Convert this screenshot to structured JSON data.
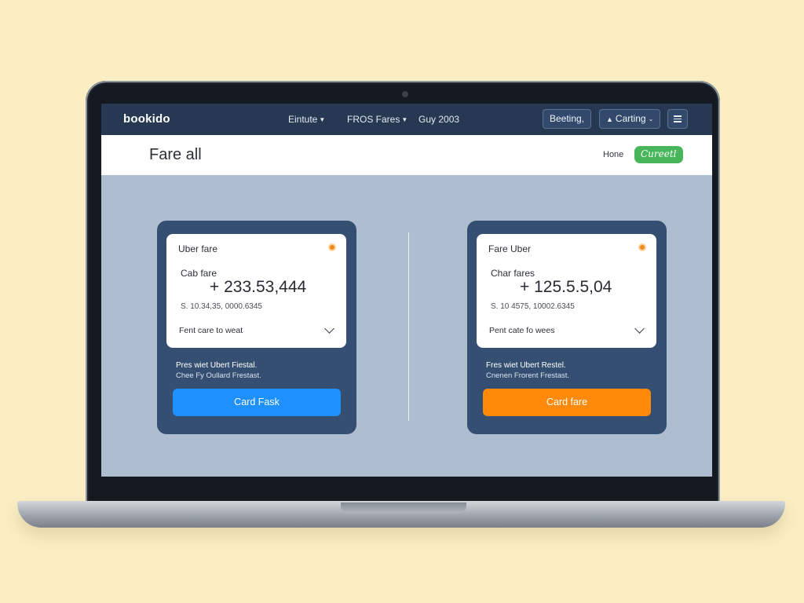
{
  "navbar": {
    "logo": "bookido",
    "links": [
      "Eintute",
      "FROS Fares",
      "Guy 2003"
    ],
    "booking_label": "Beeting,",
    "setting_label": "Carting"
  },
  "titlebar": {
    "title": "Fare all",
    "home_label": "Hone",
    "current_label": "Cureetl"
  },
  "cards": [
    {
      "header": "Uber fare",
      "label": "Cab fare",
      "amount": "+ 233.53,444",
      "sub": "S. 10.34,35, 0000.6345",
      "select": "Fent care to weat",
      "note1": "Pres wiet Ubert Fiestal.",
      "note2": "Chee  Fy Oullard Frestast.",
      "button_label": "Card Fask",
      "button_color": "#1e90ff"
    },
    {
      "header": "Fare Uber",
      "label": "Char fares",
      "amount": "+ 125.5.5,04",
      "sub": "S. 10 4575, 10002.6345",
      "select": "Pent cate fo wees",
      "note1": "Fres wiet Ubert Restel.",
      "note2": "Cnenen Frorent Frestast.",
      "button_label": "Card fare",
      "button_color": "#ff8a0a"
    }
  ],
  "colors": {
    "page_bg": "#fbeec3",
    "navbar_bg": "#263852",
    "screen_bg": "#aebdcf",
    "card_bg": "#344f71",
    "current_badge": "#47b55a"
  }
}
